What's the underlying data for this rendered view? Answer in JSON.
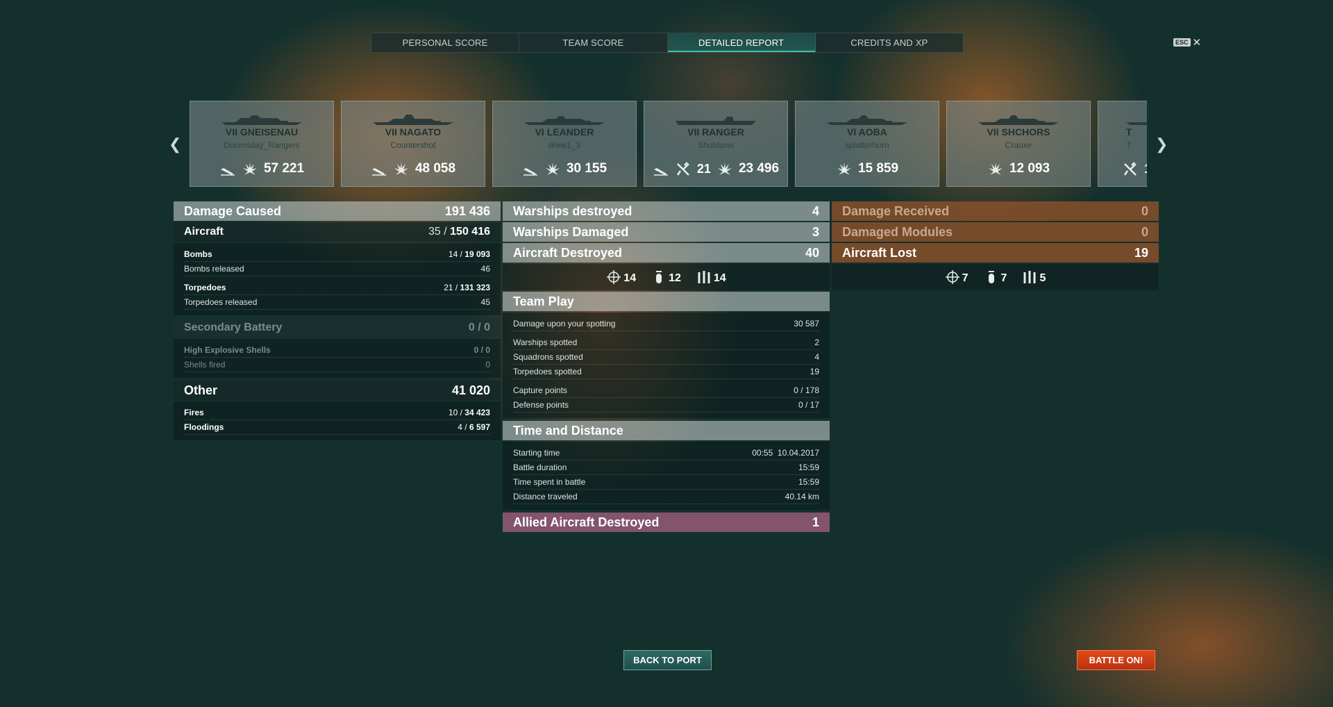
{
  "tabs": [
    "PERSONAL SCORE",
    "TEAM SCORE",
    "DETAILED REPORT",
    "CREDITS AND XP"
  ],
  "esc": {
    "key": "ESC",
    "close": "✕"
  },
  "ships": [
    {
      "name": "VII GNEISENAU",
      "player": "Doomsday_Rangers",
      "damage": "57 221",
      "planes": ""
    },
    {
      "name": "VII NAGATO",
      "player": "Countershot",
      "damage": "48 058",
      "planes": ""
    },
    {
      "name": "VI LEANDER",
      "player": "drew1_3",
      "damage": "30 155",
      "planes": ""
    },
    {
      "name": "VII RANGER",
      "player": "Shotdunn",
      "damage": "23 496",
      "planes": "21"
    },
    {
      "name": "VI AOBA",
      "player": "splatterhorn",
      "damage": "15 859",
      "planes": ""
    },
    {
      "name": "VII SHCHORS",
      "player": "Crauxe",
      "damage": "12 093",
      "planes": ""
    },
    {
      "name": "T",
      "player": "T",
      "damage": "",
      "planes": "1"
    }
  ],
  "left": {
    "damage_caused": {
      "label": "Damage Caused",
      "value": "191 436"
    },
    "aircraft": {
      "label": "Aircraft",
      "hits": "35 /",
      "value": "150 416"
    },
    "bombs": {
      "label": "Bombs",
      "hits": "14 /",
      "value": "19 093"
    },
    "bombs_released": {
      "label": "Bombs released",
      "value": "46"
    },
    "torpedoes": {
      "label": "Torpedoes",
      "hits": "21 /",
      "value": "131 323"
    },
    "torpedoes_released": {
      "label": "Torpedoes released",
      "value": "45"
    },
    "secondary": {
      "label": "Secondary Battery",
      "value": "0 / 0"
    },
    "he_shells": {
      "label": "High Explosive Shells",
      "value": "0 / 0"
    },
    "shells_fired": {
      "label": "Shells fired",
      "value": "0"
    },
    "other": {
      "label": "Other",
      "value": "41 020"
    },
    "fires": {
      "label": "Fires",
      "hits": "10 /",
      "value": "34 423"
    },
    "floodings": {
      "label": "Floodings",
      "hits": "4 /",
      "value": "6 597"
    }
  },
  "middle": {
    "warships_destroyed": {
      "label": "Warships destroyed",
      "value": "4"
    },
    "warships_damaged": {
      "label": "Warships Damaged",
      "value": "3"
    },
    "aircraft_destroyed": {
      "label": "Aircraft Destroyed",
      "value": "40"
    },
    "icons": {
      "fighter": "14",
      "bomber": "12",
      "torpedo": "14"
    },
    "team_play": {
      "label": "Team Play",
      "damage_spotting": {
        "label": "Damage upon your spotting",
        "value": "30 587"
      },
      "warships_spotted": {
        "label": "Warships spotted",
        "value": "2"
      },
      "squadrons_spotted": {
        "label": "Squadrons spotted",
        "value": "4"
      },
      "torpedoes_spotted": {
        "label": "Torpedoes spotted",
        "value": "19"
      },
      "capture_points": {
        "label": "Capture points",
        "value": "0 / 178"
      },
      "defense_points": {
        "label": "Defense points",
        "value": "0 / 17"
      }
    },
    "time_distance": {
      "label": "Time and Distance",
      "starting_time": {
        "label": "Starting time",
        "value": "00:55  10.04.2017"
      },
      "battle_duration": {
        "label": "Battle duration",
        "value": "15:59"
      },
      "time_in_battle": {
        "label": "Time spent in battle",
        "value": "15:59"
      },
      "distance": {
        "label": "Distance traveled",
        "value": "40.14 km"
      }
    },
    "allied_aircraft": {
      "label": "Allied Aircraft Destroyed",
      "value": "1"
    }
  },
  "right": {
    "damage_received": {
      "label": "Damage Received",
      "value": "0"
    },
    "damaged_modules": {
      "label": "Damaged Modules",
      "value": "0"
    },
    "aircraft_lost": {
      "label": "Aircraft Lost",
      "value": "19"
    },
    "icons": {
      "fighter": "7",
      "bomber": "7",
      "torpedo": "5"
    }
  },
  "buttons": {
    "back": "BACK TO PORT",
    "battle": "BATTLE ON!"
  }
}
